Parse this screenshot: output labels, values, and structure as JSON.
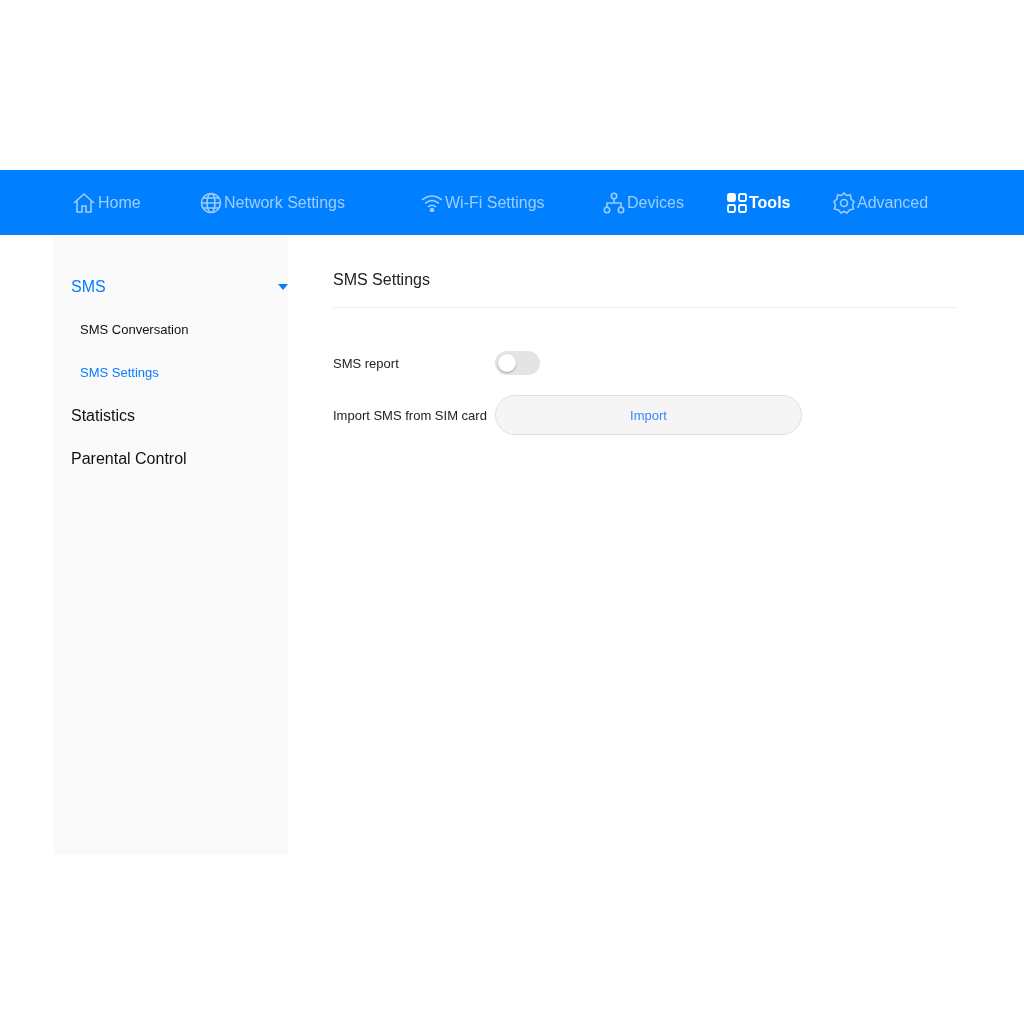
{
  "nav": [
    {
      "label": "Home",
      "selected": false
    },
    {
      "label": "Network Settings",
      "selected": false
    },
    {
      "label": "Wi-Fi Settings",
      "selected": false
    },
    {
      "label": "Devices",
      "selected": false
    },
    {
      "label": "Tools",
      "selected": true
    },
    {
      "label": "Advanced",
      "selected": false
    }
  ],
  "sidebar": {
    "items": [
      {
        "label": "SMS",
        "expanded": true,
        "children": [
          {
            "label": "SMS Conversation",
            "selected": false
          },
          {
            "label": "SMS Settings",
            "selected": true
          }
        ]
      },
      {
        "label": "Statistics",
        "expanded": false
      },
      {
        "label": "Parental Control",
        "expanded": false
      }
    ]
  },
  "content": {
    "title": "SMS Settings",
    "settings": [
      {
        "kind": "toggle",
        "label": "SMS report",
        "on": false
      },
      {
        "kind": "button",
        "label": "Import SMS from SIM card",
        "button": "Import"
      }
    ]
  }
}
